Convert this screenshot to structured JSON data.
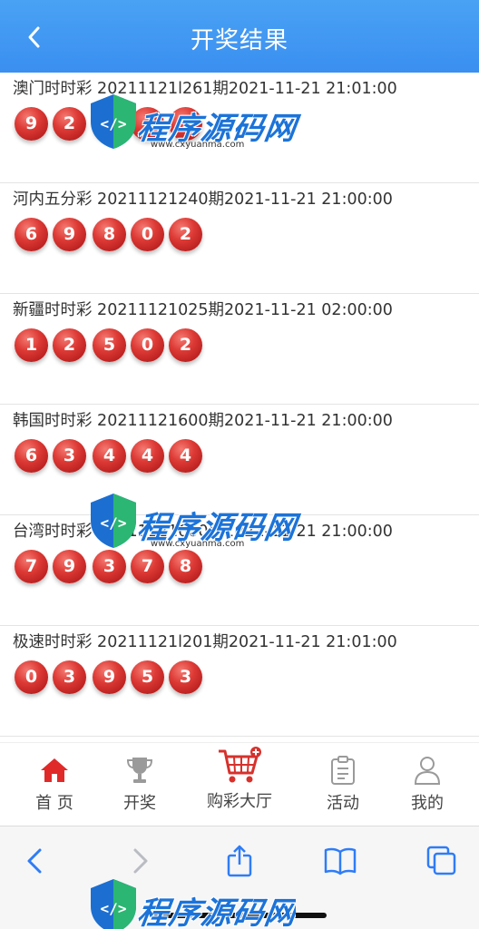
{
  "header": {
    "title": "开奖结果",
    "back_icon": "chevron-left-icon"
  },
  "results": [
    {
      "line": "澳门时时彩 20211121l261期2021-11-21 21:01:00",
      "numbers": [
        "9",
        "2",
        "",
        "",
        "7"
      ]
    },
    {
      "line": "河内五分彩 20211121240期2021-11-21 21:00:00",
      "numbers": [
        "6",
        "9",
        "8",
        "0",
        "2"
      ]
    },
    {
      "line": "新疆时时彩 20211121025期2021-11-21 02:00:00",
      "numbers": [
        "1",
        "2",
        "5",
        "0",
        "2"
      ]
    },
    {
      "line": "韩国时时彩 20211121600期2021-11-21 21:00:00",
      "numbers": [
        "6",
        "3",
        "4",
        "4",
        "4"
      ]
    },
    {
      "line": "台湾时时彩 20211121600期2021-11-21 21:00:00",
      "numbers": [
        "7",
        "9",
        "3",
        "7",
        "8"
      ]
    },
    {
      "line": "极速时时彩 20211121l201期2021-11-21 21:01:00",
      "numbers": [
        "0",
        "3",
        "9",
        "5",
        "3"
      ]
    }
  ],
  "tabbar": {
    "items": [
      {
        "label": "首 页",
        "icon": "home-icon",
        "active": true
      },
      {
        "label": "开奖",
        "icon": "trophy-icon",
        "active": false
      },
      {
        "label": "购彩大厅",
        "icon": "shopping-cart-icon",
        "active": false
      },
      {
        "label": "活动",
        "icon": "clipboard-icon",
        "active": false
      },
      {
        "label": "我的",
        "icon": "user-icon",
        "active": false
      }
    ]
  },
  "browser_toolbar": {
    "icons": [
      "back-icon",
      "forward-icon",
      "share-icon",
      "bookmarks-icon",
      "tabs-icon"
    ]
  },
  "watermark": {
    "brand": "程序源码网",
    "url": "www.cxyuanma.com"
  },
  "colors": {
    "header": "#3a8ff0",
    "ball": "#d7312c",
    "active_tab": "#e02a2a"
  }
}
